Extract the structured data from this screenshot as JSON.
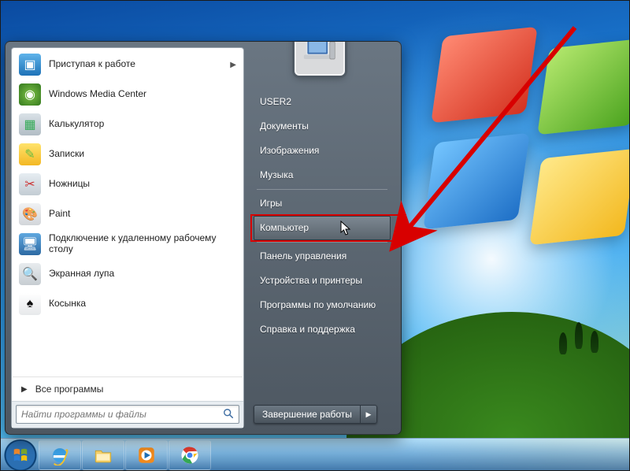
{
  "left_programs": [
    {
      "label": "Приступая к работе",
      "has_submenu": true,
      "icon": "getting-started-icon"
    },
    {
      "label": "Windows Media Center",
      "has_submenu": false,
      "icon": "media-center-icon"
    },
    {
      "label": "Калькулятор",
      "has_submenu": false,
      "icon": "calculator-icon"
    },
    {
      "label": "Записки",
      "has_submenu": false,
      "icon": "sticky-notes-icon"
    },
    {
      "label": "Ножницы",
      "has_submenu": false,
      "icon": "snipping-tool-icon"
    },
    {
      "label": "Paint",
      "has_submenu": false,
      "icon": "paint-icon"
    },
    {
      "label": "Подключение к удаленному рабочему столу",
      "has_submenu": false,
      "icon": "remote-desktop-icon"
    },
    {
      "label": "Экранная лупа",
      "has_submenu": false,
      "icon": "magnifier-icon"
    },
    {
      "label": "Косынка",
      "has_submenu": false,
      "icon": "solitaire-icon"
    }
  ],
  "all_programs_label": "Все программы",
  "search": {
    "placeholder": "Найти программы и файлы"
  },
  "right_items": [
    {
      "label": "USER2",
      "group": 0
    },
    {
      "label": "Документы",
      "group": 0
    },
    {
      "label": "Изображения",
      "group": 0
    },
    {
      "label": "Музыка",
      "group": 0
    },
    {
      "label": "Игры",
      "group": 1
    },
    {
      "label": "Компьютер",
      "group": 1,
      "highlighted": true
    },
    {
      "label": "Панель управления",
      "group": 2
    },
    {
      "label": "Устройства и принтеры",
      "group": 2
    },
    {
      "label": "Программы по умолчанию",
      "group": 2
    },
    {
      "label": "Справка и поддержка",
      "group": 2
    }
  ],
  "shutdown_label": "Завершение работы",
  "taskbar": [
    {
      "name": "start-orb",
      "type": "start"
    },
    {
      "name": "internet-explorer-icon",
      "type": "ie"
    },
    {
      "name": "file-explorer-icon",
      "type": "explorer"
    },
    {
      "name": "windows-media-player-icon",
      "type": "wmp"
    },
    {
      "name": "google-chrome-icon",
      "type": "chrome"
    }
  ],
  "annotation": {
    "highlight_target": "Компьютер"
  },
  "colors": {
    "arrow": "#d80000",
    "startmenu_right_bg": "#5a6470"
  }
}
